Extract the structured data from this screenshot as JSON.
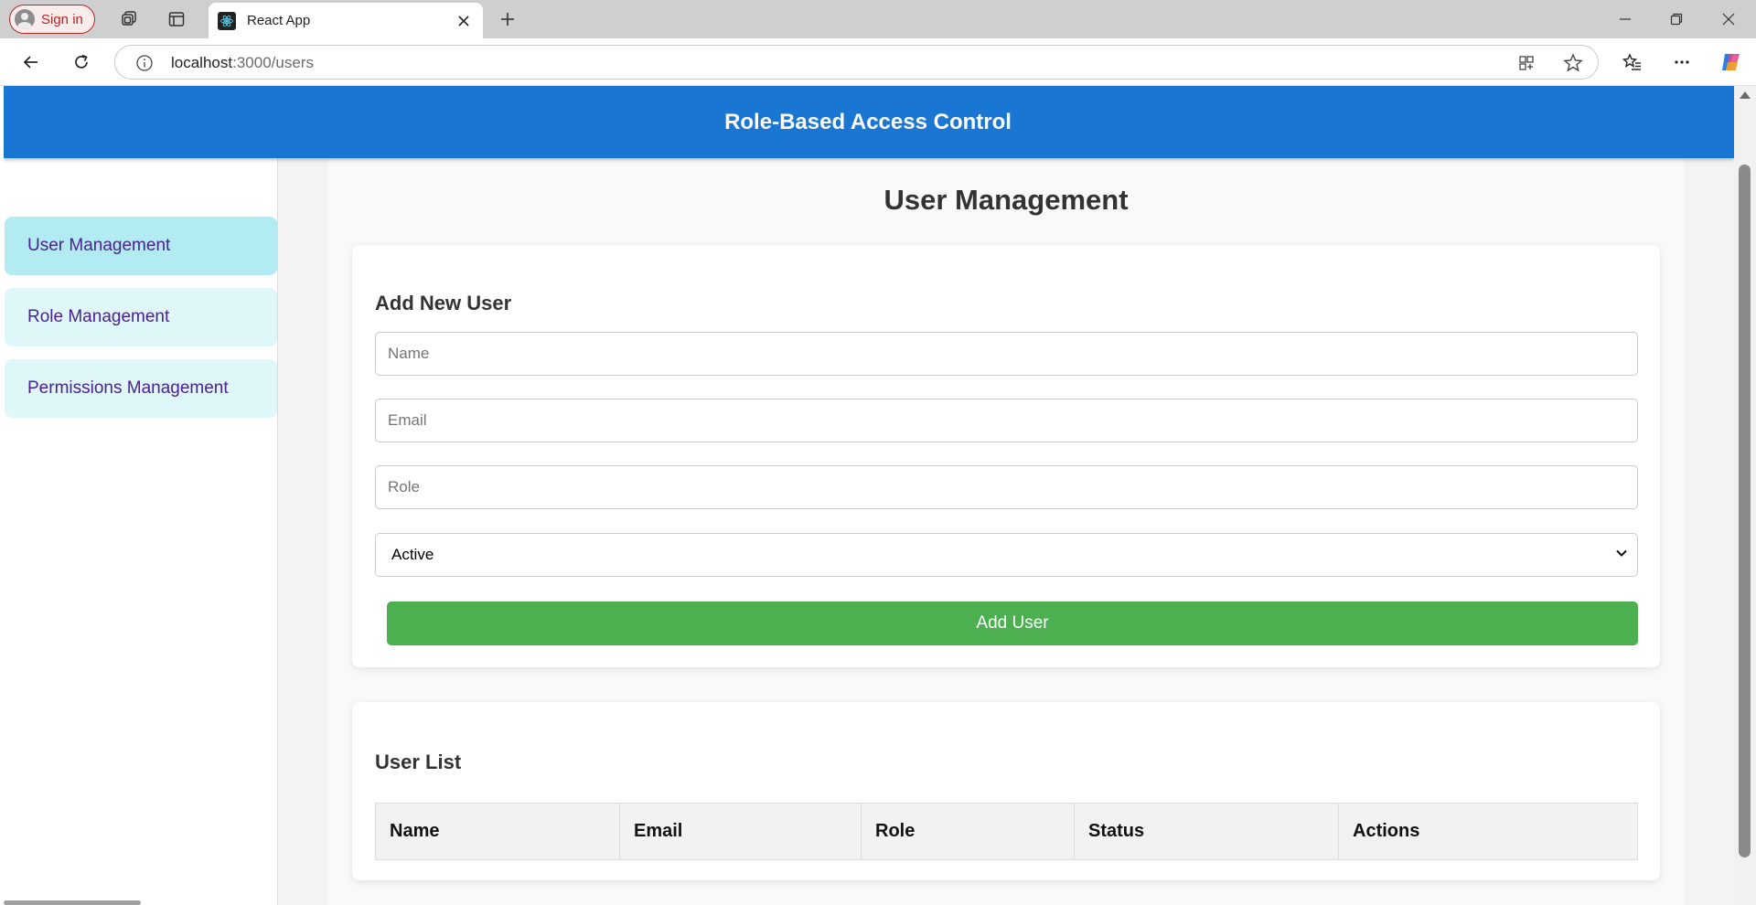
{
  "browser": {
    "sign_in_label": "Sign in",
    "tab_title": "React App",
    "url_host": "localhost",
    "url_path": ":3000/users",
    "icons": [
      "person-icon",
      "workspaces-icon",
      "tab-actions-icon",
      "react-logo-icon",
      "close-icon",
      "plus-icon",
      "minimize-icon",
      "restore-icon",
      "close-window-icon",
      "back-icon",
      "refresh-icon",
      "info-icon",
      "app-available-icon",
      "star-icon",
      "favorites-icon",
      "more-icon",
      "copilot-icon"
    ]
  },
  "header": {
    "title": "Role-Based Access Control",
    "color": "#1976d2"
  },
  "sidebar": {
    "items": [
      {
        "label": "User Management",
        "active": true
      },
      {
        "label": "Role Management",
        "active": false
      },
      {
        "label": "Permissions Management",
        "active": false
      }
    ]
  },
  "main": {
    "title": "User Management",
    "add_form": {
      "heading": "Add New User",
      "name_placeholder": "Name",
      "email_placeholder": "Email",
      "role_placeholder": "Role",
      "status_value": "Active",
      "submit_label": "Add User",
      "submit_color": "#4caf50"
    },
    "user_list": {
      "heading": "User List",
      "columns": [
        "Name",
        "Email",
        "Role",
        "Status",
        "Actions"
      ]
    }
  }
}
